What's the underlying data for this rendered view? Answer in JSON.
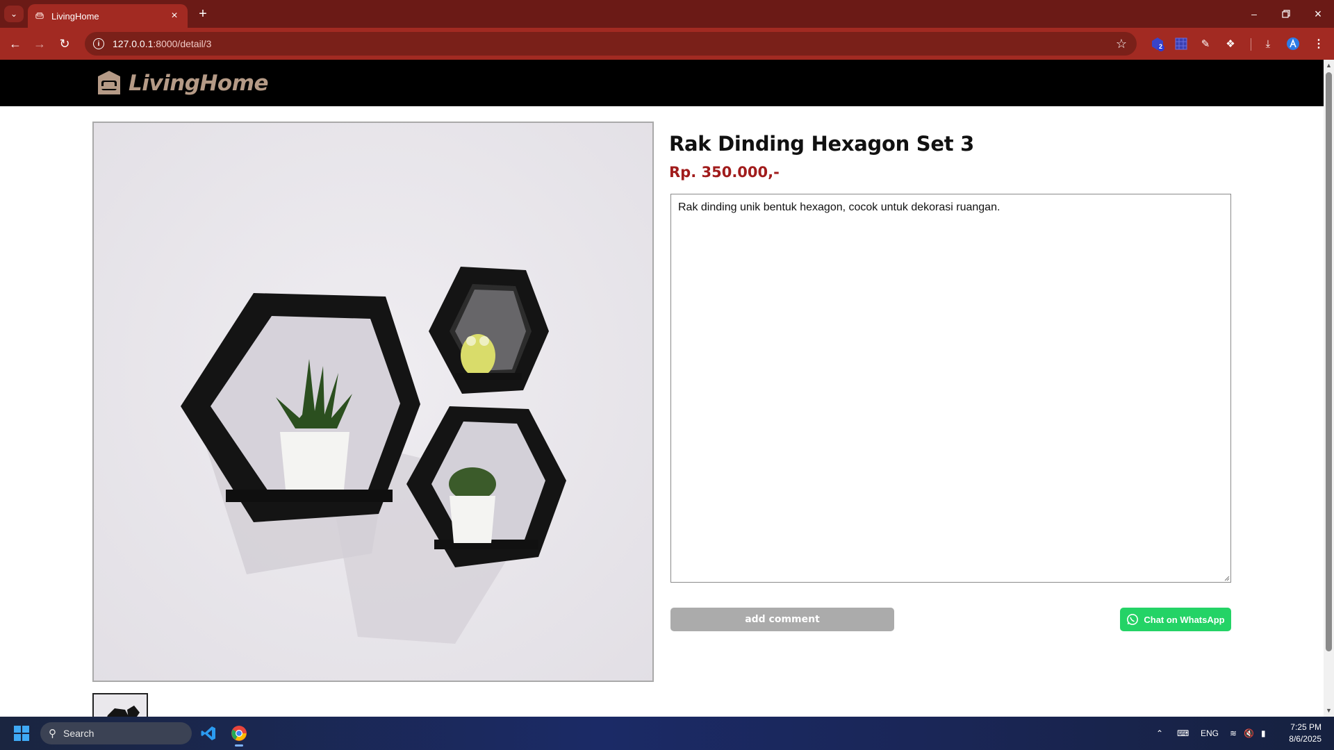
{
  "browser": {
    "tab_title": "LivingHome",
    "url_host": "127.0.0.1",
    "url_path": ":8000/detail/3",
    "extension_badge": "2"
  },
  "site": {
    "brand": "LivingHome"
  },
  "product": {
    "title": "Rak Dinding Hexagon Set 3",
    "price": "Rp. 350.000,-",
    "description": "Rak dinding unik bentuk hexagon, cocok untuk dekorasi ruangan."
  },
  "actions": {
    "add_comment_label": "add comment",
    "whatsapp_label": "Chat on WhatsApp"
  },
  "taskbar": {
    "search_placeholder": "Search",
    "language": "ENG",
    "time": "7:25 PM",
    "date": "8/6/2025"
  },
  "colors": {
    "browser_frame": "#6b1a16",
    "browser_toolbar": "#a22a22",
    "header_bg": "#000000",
    "logo": "#b59a86",
    "price": "#a11c1c",
    "add_comment_bg": "#ababab",
    "whatsapp_bg": "#24d366"
  },
  "icons": {
    "tab_search": "chevron-down-icon",
    "favicon": "sofa-icon",
    "tab_close": "close-icon",
    "new_tab": "plus-icon",
    "back": "arrow-left-icon",
    "forward": "arrow-right-icon",
    "reload": "reload-icon",
    "site_info": "info-icon",
    "bookmark": "star-icon",
    "download": "download-icon",
    "menu": "kebab-menu-icon"
  }
}
